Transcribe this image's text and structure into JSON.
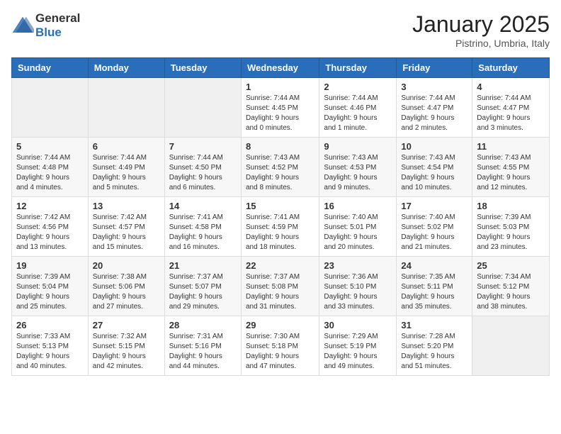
{
  "logo": {
    "text_general": "General",
    "text_blue": "Blue"
  },
  "header": {
    "month": "January 2025",
    "location": "Pistrino, Umbria, Italy"
  },
  "weekdays": [
    "Sunday",
    "Monday",
    "Tuesday",
    "Wednesday",
    "Thursday",
    "Friday",
    "Saturday"
  ],
  "weeks": [
    [
      {
        "day": "",
        "info": ""
      },
      {
        "day": "",
        "info": ""
      },
      {
        "day": "",
        "info": ""
      },
      {
        "day": "1",
        "info": "Sunrise: 7:44 AM\nSunset: 4:45 PM\nDaylight: 9 hours\nand 0 minutes."
      },
      {
        "day": "2",
        "info": "Sunrise: 7:44 AM\nSunset: 4:46 PM\nDaylight: 9 hours\nand 1 minute."
      },
      {
        "day": "3",
        "info": "Sunrise: 7:44 AM\nSunset: 4:47 PM\nDaylight: 9 hours\nand 2 minutes."
      },
      {
        "day": "4",
        "info": "Sunrise: 7:44 AM\nSunset: 4:47 PM\nDaylight: 9 hours\nand 3 minutes."
      }
    ],
    [
      {
        "day": "5",
        "info": "Sunrise: 7:44 AM\nSunset: 4:48 PM\nDaylight: 9 hours\nand 4 minutes."
      },
      {
        "day": "6",
        "info": "Sunrise: 7:44 AM\nSunset: 4:49 PM\nDaylight: 9 hours\nand 5 minutes."
      },
      {
        "day": "7",
        "info": "Sunrise: 7:44 AM\nSunset: 4:50 PM\nDaylight: 9 hours\nand 6 minutes."
      },
      {
        "day": "8",
        "info": "Sunrise: 7:43 AM\nSunset: 4:52 PM\nDaylight: 9 hours\nand 8 minutes."
      },
      {
        "day": "9",
        "info": "Sunrise: 7:43 AM\nSunset: 4:53 PM\nDaylight: 9 hours\nand 9 minutes."
      },
      {
        "day": "10",
        "info": "Sunrise: 7:43 AM\nSunset: 4:54 PM\nDaylight: 9 hours\nand 10 minutes."
      },
      {
        "day": "11",
        "info": "Sunrise: 7:43 AM\nSunset: 4:55 PM\nDaylight: 9 hours\nand 12 minutes."
      }
    ],
    [
      {
        "day": "12",
        "info": "Sunrise: 7:42 AM\nSunset: 4:56 PM\nDaylight: 9 hours\nand 13 minutes."
      },
      {
        "day": "13",
        "info": "Sunrise: 7:42 AM\nSunset: 4:57 PM\nDaylight: 9 hours\nand 15 minutes."
      },
      {
        "day": "14",
        "info": "Sunrise: 7:41 AM\nSunset: 4:58 PM\nDaylight: 9 hours\nand 16 minutes."
      },
      {
        "day": "15",
        "info": "Sunrise: 7:41 AM\nSunset: 4:59 PM\nDaylight: 9 hours\nand 18 minutes."
      },
      {
        "day": "16",
        "info": "Sunrise: 7:40 AM\nSunset: 5:01 PM\nDaylight: 9 hours\nand 20 minutes."
      },
      {
        "day": "17",
        "info": "Sunrise: 7:40 AM\nSunset: 5:02 PM\nDaylight: 9 hours\nand 21 minutes."
      },
      {
        "day": "18",
        "info": "Sunrise: 7:39 AM\nSunset: 5:03 PM\nDaylight: 9 hours\nand 23 minutes."
      }
    ],
    [
      {
        "day": "19",
        "info": "Sunrise: 7:39 AM\nSunset: 5:04 PM\nDaylight: 9 hours\nand 25 minutes."
      },
      {
        "day": "20",
        "info": "Sunrise: 7:38 AM\nSunset: 5:06 PM\nDaylight: 9 hours\nand 27 minutes."
      },
      {
        "day": "21",
        "info": "Sunrise: 7:37 AM\nSunset: 5:07 PM\nDaylight: 9 hours\nand 29 minutes."
      },
      {
        "day": "22",
        "info": "Sunrise: 7:37 AM\nSunset: 5:08 PM\nDaylight: 9 hours\nand 31 minutes."
      },
      {
        "day": "23",
        "info": "Sunrise: 7:36 AM\nSunset: 5:10 PM\nDaylight: 9 hours\nand 33 minutes."
      },
      {
        "day": "24",
        "info": "Sunrise: 7:35 AM\nSunset: 5:11 PM\nDaylight: 9 hours\nand 35 minutes."
      },
      {
        "day": "25",
        "info": "Sunrise: 7:34 AM\nSunset: 5:12 PM\nDaylight: 9 hours\nand 38 minutes."
      }
    ],
    [
      {
        "day": "26",
        "info": "Sunrise: 7:33 AM\nSunset: 5:13 PM\nDaylight: 9 hours\nand 40 minutes."
      },
      {
        "day": "27",
        "info": "Sunrise: 7:32 AM\nSunset: 5:15 PM\nDaylight: 9 hours\nand 42 minutes."
      },
      {
        "day": "28",
        "info": "Sunrise: 7:31 AM\nSunset: 5:16 PM\nDaylight: 9 hours\nand 44 minutes."
      },
      {
        "day": "29",
        "info": "Sunrise: 7:30 AM\nSunset: 5:18 PM\nDaylight: 9 hours\nand 47 minutes."
      },
      {
        "day": "30",
        "info": "Sunrise: 7:29 AM\nSunset: 5:19 PM\nDaylight: 9 hours\nand 49 minutes."
      },
      {
        "day": "31",
        "info": "Sunrise: 7:28 AM\nSunset: 5:20 PM\nDaylight: 9 hours\nand 51 minutes."
      },
      {
        "day": "",
        "info": ""
      }
    ]
  ]
}
